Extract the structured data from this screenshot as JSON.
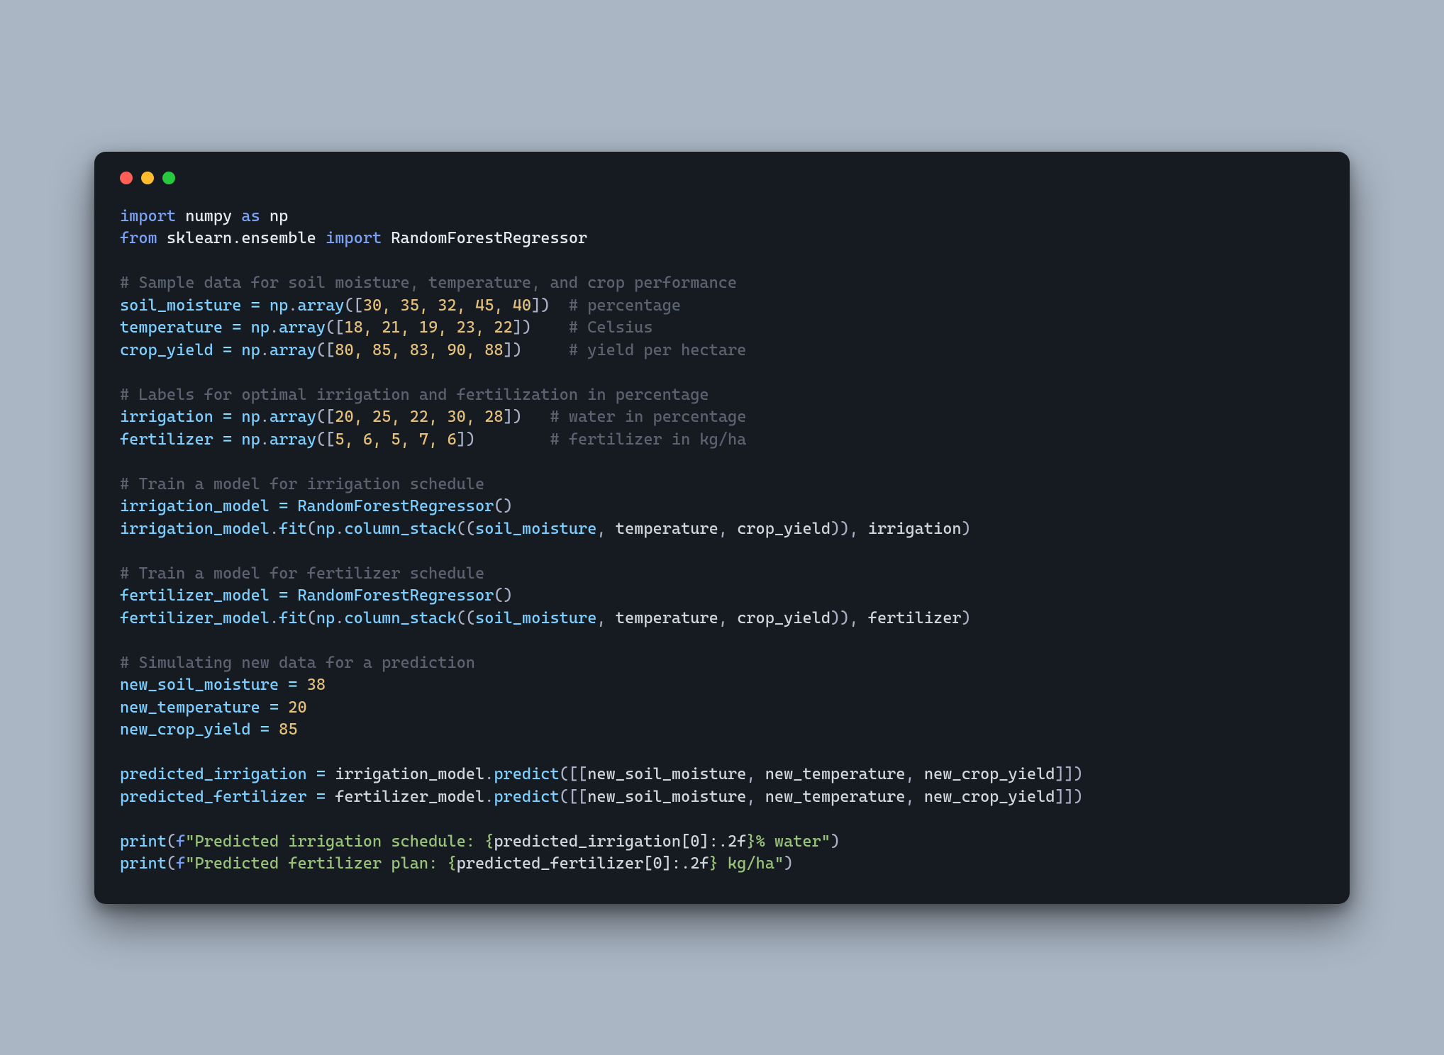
{
  "window": {
    "traffic_lights": [
      "close",
      "minimize",
      "zoom"
    ]
  },
  "code": {
    "line1": {
      "kw1": "import",
      "mod": "numpy",
      "kw2": "as",
      "alias": "np"
    },
    "line2": {
      "kw1": "from",
      "mod": "sklearn.ensemble",
      "kw2": "import",
      "cls": "RandomForestRegressor"
    },
    "c1": "# Sample data for soil moisture, temperature, and crop performance",
    "sm": {
      "name": "soil_moisture",
      "vals": "30, 35, 32, 45, 40",
      "cm": "# percentage"
    },
    "tp": {
      "name": "temperature",
      "vals": "18, 21, 19, 23, 22",
      "cm": "# Celsius"
    },
    "cy": {
      "name": "crop_yield",
      "vals": "80, 85, 83, 90, 88",
      "cm": "# yield per hectare"
    },
    "c2": "# Labels for optimal irrigation and fertilization in percentage",
    "ir": {
      "name": "irrigation",
      "vals": "20, 25, 22, 30, 28",
      "cm": "# water in percentage"
    },
    "fz": {
      "name": "fertilizer",
      "vals": "5, 6, 5, 7, 6",
      "cm": "# fertilizer in kg/ha"
    },
    "c3": "# Train a model for irrigation schedule",
    "im_assign": {
      "name": "irrigation_model",
      "cls": "RandomForestRegressor"
    },
    "im_fit": {
      "obj": "irrigation_model",
      "a1": "soil_moisture",
      "a2": "temperature",
      "a3": "crop_yield",
      "y": "irrigation"
    },
    "c4": "# Train a model for fertilizer schedule",
    "fm_assign": {
      "name": "fertilizer_model",
      "cls": "RandomForestRegressor"
    },
    "fm_fit": {
      "obj": "fertilizer_model",
      "a1": "soil_moisture",
      "a2": "temperature",
      "a3": "crop_yield",
      "y": "fertilizer"
    },
    "c5": "# Simulating new data for a prediction",
    "nsm": {
      "name": "new_soil_moisture",
      "val": "38"
    },
    "ntp": {
      "name": "new_temperature",
      "val": "20"
    },
    "ncy": {
      "name": "new_crop_yield",
      "val": "85"
    },
    "pi": {
      "name": "predicted_irrigation",
      "obj": "irrigation_model",
      "a1": "new_soil_moisture",
      "a2": "new_temperature",
      "a3": "new_crop_yield"
    },
    "pf": {
      "name": "predicted_fertilizer",
      "obj": "fertilizer_model",
      "a1": "new_soil_moisture",
      "a2": "new_temperature",
      "a3": "new_crop_yield"
    },
    "pr1": {
      "pre": "\"Predicted irrigation schedule: ",
      "exp": "predicted_irrigation[0]:.2f",
      "suf": "% water\""
    },
    "pr2": {
      "pre": "\"Predicted fertilizer plan: ",
      "exp": "predicted_fertilizer[0]:.2f",
      "suf": " kg/ha\""
    },
    "tokens": {
      "np": "np",
      "array": "array",
      "column_stack": "column_stack",
      "fit": "fit",
      "predict": "predict",
      "print": "print",
      "f": "f",
      "eq": " = "
    }
  },
  "colors": {
    "bg_page": "#aab6c4",
    "bg_window": "#161b22",
    "red": "#ff5f56",
    "yellow": "#ffbd2e",
    "green": "#27c93f",
    "keyword": "#7aa2f7",
    "identifier": "#7dcfff",
    "number": "#e5c07b",
    "string": "#98c379",
    "comment": "#5c6370",
    "plain": "#d0d6dd"
  }
}
